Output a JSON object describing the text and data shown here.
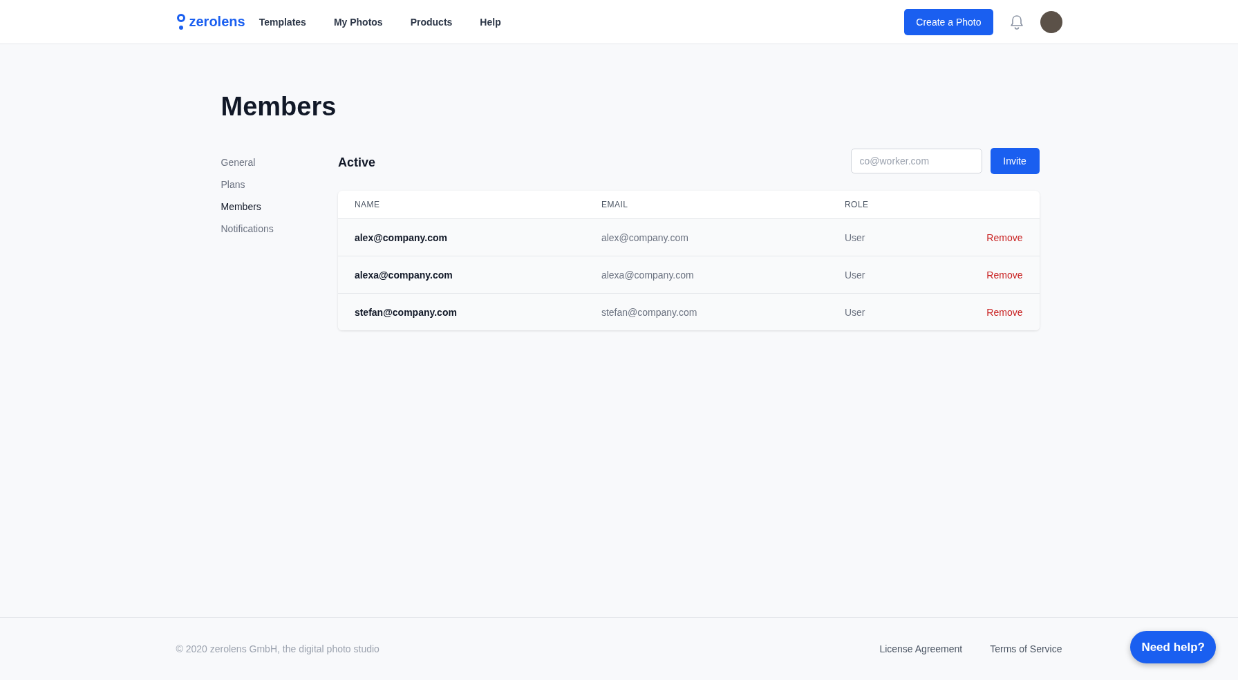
{
  "header": {
    "logo": "zerolens",
    "nav": [
      {
        "label": "Templates"
      },
      {
        "label": "My Photos"
      },
      {
        "label": "Products"
      },
      {
        "label": "Help"
      }
    ],
    "create_button": "Create a Photo"
  },
  "page_title": "Members",
  "sidebar": {
    "items": [
      {
        "label": "General",
        "selected": false
      },
      {
        "label": "Plans",
        "selected": false
      },
      {
        "label": "Members",
        "selected": true
      },
      {
        "label": "Notifications",
        "selected": false
      }
    ]
  },
  "section_title": "Active",
  "invite": {
    "placeholder": "co@worker.com",
    "button": "Invite"
  },
  "table": {
    "columns": [
      "NAME",
      "EMAIL",
      "ROLE"
    ],
    "rows": [
      {
        "name": "alex@company.com",
        "email": "alex@company.com",
        "role": "User",
        "action": "Remove"
      },
      {
        "name": "alexa@company.com",
        "email": "alexa@company.com",
        "role": "User",
        "action": "Remove"
      },
      {
        "name": "stefan@company.com",
        "email": "stefan@company.com",
        "role": "User",
        "action": "Remove"
      }
    ]
  },
  "footer": {
    "copyright": "© 2020 zerolens GmbH, the digital photo studio",
    "links": [
      "License Agreement",
      "Terms of Service"
    ],
    "help_button": "Need help?"
  }
}
